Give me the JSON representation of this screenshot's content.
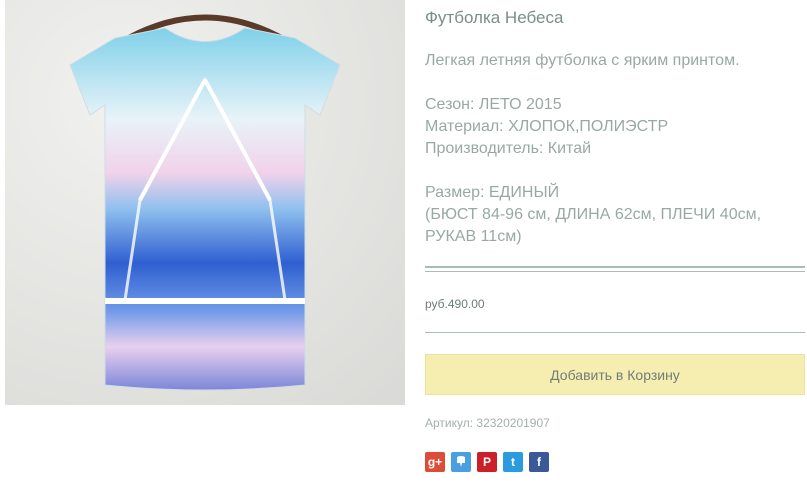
{
  "product": {
    "title": "Футболка Небеса",
    "description": "Легкая летняя футболка с ярким принтом.",
    "season": "Сезон: ЛЕТО 2015",
    "material": "Материал: ХЛОПОК,ПОЛИЭСТР",
    "manufacturer": "Производитель: Китай",
    "size": "Размер: ЕДИНЫЙ",
    "measurements_line1": "(БЮСТ 84-96 см, ДЛИНА 62см, ПЛЕЧИ 40см,",
    "measurements_line2": "РУКАВ 11см)",
    "price": "руб.490.00",
    "add_to_cart": "Добавить в Корзину",
    "sku": "Артикул: 32320201907"
  },
  "share": [
    {
      "name": "google-plus-icon",
      "glyph": "g+",
      "color": "#dd4b39"
    },
    {
      "name": "odnoklassniki-icon",
      "glyph": "",
      "color": "#4a9fe0"
    },
    {
      "name": "pinterest-icon",
      "glyph": "P",
      "color": "#cb2027"
    },
    {
      "name": "twitter-icon",
      "glyph": "t",
      "color": "#2b9be0"
    },
    {
      "name": "facebook-icon",
      "glyph": "f",
      "color": "#3b5998"
    }
  ]
}
